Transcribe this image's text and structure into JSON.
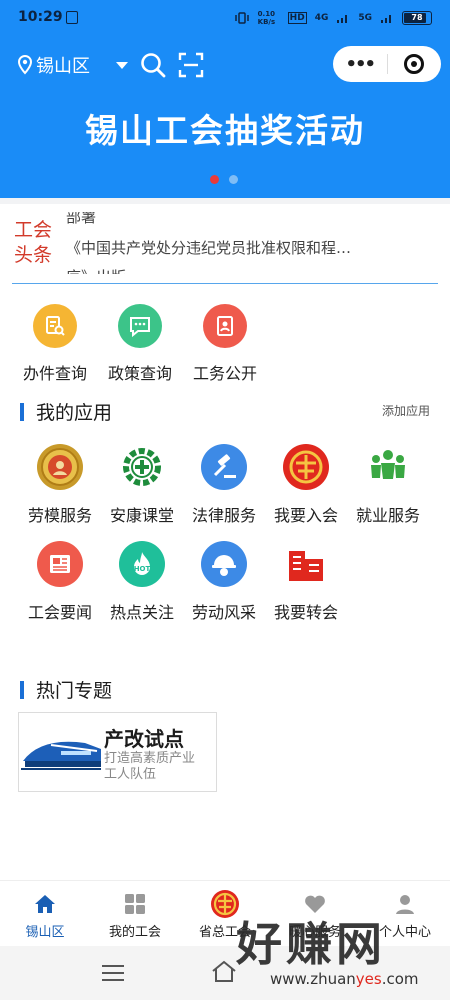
{
  "status_bar": {
    "time": "10:29",
    "net_speed": "0.10 KB/s",
    "hd": "HD",
    "net4g": "4G",
    "net5g": "5G",
    "battery": "78"
  },
  "header": {
    "location": "锡山区",
    "banner_title": "锡山工会抽奖活动",
    "icons": [
      "location-pin-icon",
      "search-icon",
      "scan-icon",
      "more-icon",
      "close-icon"
    ]
  },
  "news": {
    "label_line1": "工会",
    "label_line2": "头条",
    "line_top": "部署",
    "line_main": "《中国共产党处分违纪党员批准权限和程…",
    "line_bottom": "序》出版"
  },
  "quick_services": [
    {
      "label": "办件查询",
      "icon": "document-search-icon",
      "color": "#f5b533"
    },
    {
      "label": "政策查询",
      "icon": "chat-icon",
      "color": "#3cc489"
    },
    {
      "label": "工务公开",
      "icon": "document-person-icon",
      "color": "#ef5a4c"
    }
  ],
  "my_apps": {
    "title": "我的应用",
    "add_label": "添加应用",
    "items": [
      {
        "label": "劳模服务",
        "icon": "model-worker-icon"
      },
      {
        "label": "安康课堂",
        "icon": "health-cross-icon"
      },
      {
        "label": "法律服务",
        "icon": "gavel-icon"
      },
      {
        "label": "我要入会",
        "icon": "union-emblem-icon"
      },
      {
        "label": "就业服务",
        "icon": "people-group-icon"
      },
      {
        "label": "工会要闻",
        "icon": "newspaper-icon"
      },
      {
        "label": "热点关注",
        "icon": "hot-icon"
      },
      {
        "label": "劳动风采",
        "icon": "worker-helmet-icon"
      },
      {
        "label": "我要转会",
        "icon": "building-icon"
      }
    ]
  },
  "hot_topics": {
    "title": "热门专题",
    "card": {
      "title": "产改试点",
      "desc_line1": "打造高素质产业",
      "desc_line2": "工人队伍",
      "icon": "train-icon"
    }
  },
  "tab_bar": [
    {
      "label": "锡山区",
      "icon": "home-icon",
      "active": true
    },
    {
      "label": "我的工会",
      "icon": "grid-icon",
      "active": false
    },
    {
      "label": "省总工会",
      "icon": "union-emblem-icon",
      "active": false
    },
    {
      "label": "暖心服务",
      "icon": "heart-icon",
      "active": false
    },
    {
      "label": "个人中心",
      "icon": "person-icon",
      "active": false
    }
  ],
  "watermark": {
    "big": "好赚网",
    "small_pre": "www.zhuan",
    "small_red": "yes",
    "small_post": ".com"
  },
  "colors": {
    "header_blue": "#1a8cf7",
    "headline_red": "#d23a2a",
    "accent_blue": "#1a6fd6",
    "active_dot": "#e83a3a"
  }
}
